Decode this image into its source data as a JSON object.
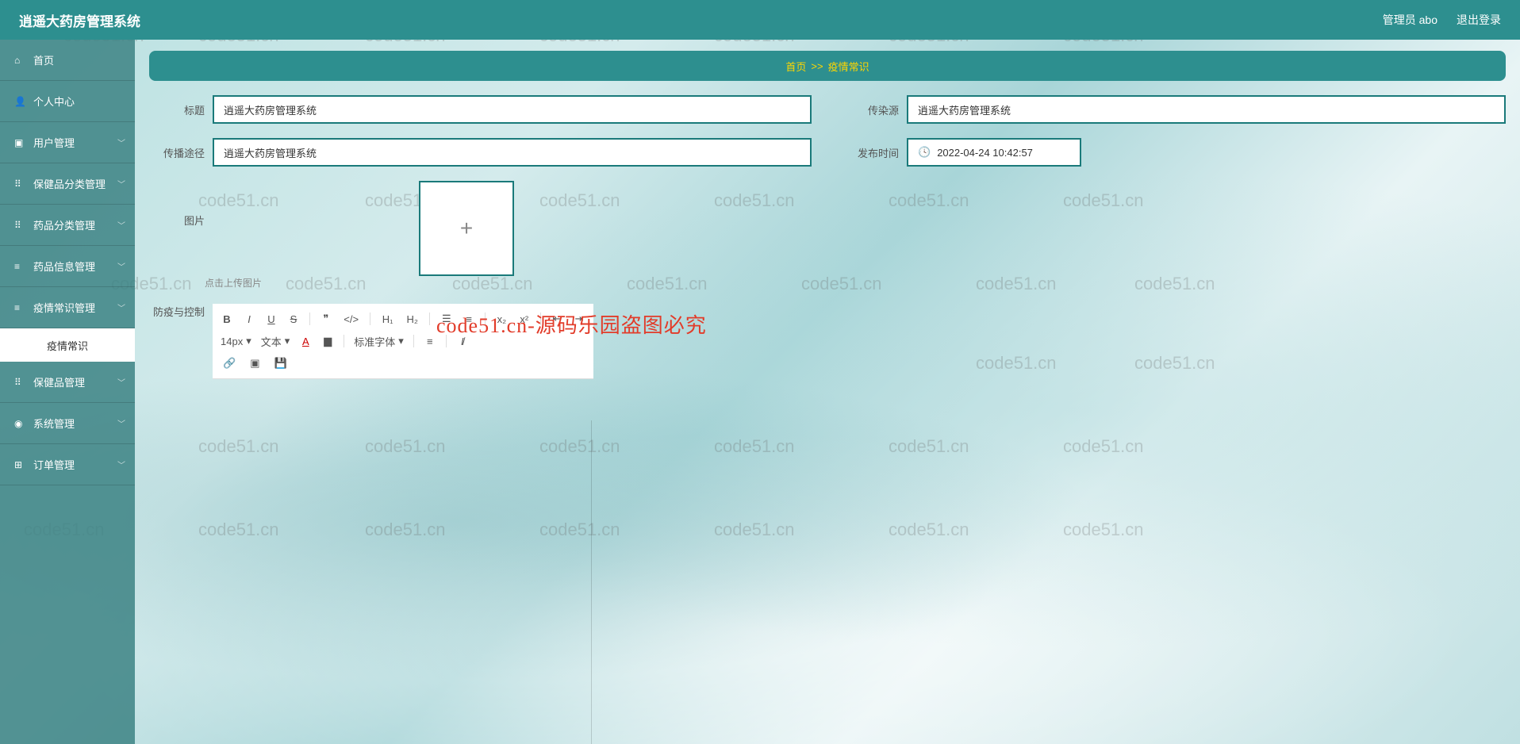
{
  "header": {
    "title": "逍遥大药房管理系统",
    "admin_label": "管理员 abo",
    "logout_label": "退出登录"
  },
  "sidebar": {
    "items": [
      {
        "icon": "home",
        "label": "首页"
      },
      {
        "icon": "user",
        "label": "个人中心"
      },
      {
        "icon": "users",
        "label": "用户管理"
      },
      {
        "icon": "grid",
        "label": "保健品分类管理"
      },
      {
        "icon": "grid",
        "label": "药品分类管理"
      },
      {
        "icon": "list",
        "label": "药品信息管理"
      },
      {
        "icon": "list",
        "label": "疫情常识管理"
      },
      {
        "icon": "grid",
        "label": "保健品管理"
      },
      {
        "icon": "globe",
        "label": "系统管理"
      },
      {
        "icon": "cart",
        "label": "订单管理"
      }
    ],
    "active_sub": "疫情常识"
  },
  "breadcrumb": {
    "home": "首页",
    "sep": ">>",
    "current": "疫情常识"
  },
  "form": {
    "title_label": "标题",
    "title_value": "逍遥大药房管理系统",
    "source_label": "传染源",
    "source_value": "逍遥大药房管理系统",
    "route_label": "传播途径",
    "route_value": "逍遥大药房管理系统",
    "publish_label": "发布时间",
    "publish_value": "2022-04-24 10:42:57",
    "image_label": "图片",
    "upload_hint": "点击上传图片",
    "control_label": "防疫与控制"
  },
  "editor": {
    "font_size": "14px",
    "text_label": "文本",
    "font_family": "标准字体"
  },
  "watermark_text": "code51.cn",
  "center_text": "code51.cn-源码乐园盗图必究"
}
